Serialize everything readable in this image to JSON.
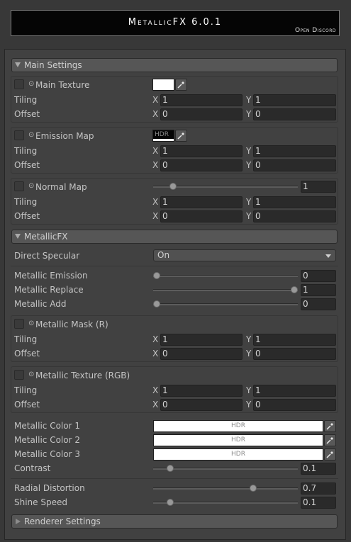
{
  "banner": {
    "title": "MetallicFX 6.0.1",
    "discord_link": "Open Discord"
  },
  "sections": {
    "main_settings": "Main Settings",
    "metallicfx": "MetallicFX",
    "renderer_settings": "Renderer Settings"
  },
  "main_texture": {
    "label": "Main Texture",
    "tiling_label": "Tiling",
    "offset_label": "Offset",
    "tiling_x": "1",
    "tiling_y": "1",
    "offset_x": "0",
    "offset_y": "0"
  },
  "emission_map": {
    "label": "Emission Map",
    "swatch_text": "HDR",
    "tiling_label": "Tiling",
    "offset_label": "Offset",
    "tiling_x": "1",
    "tiling_y": "1",
    "offset_x": "0",
    "offset_y": "0"
  },
  "normal_map": {
    "label": "Normal Map",
    "strength_value": "1",
    "strength_level": 0.12,
    "tiling_label": "Tiling",
    "offset_label": "Offset",
    "tiling_x": "1",
    "tiling_y": "1",
    "offset_x": "0",
    "offset_y": "0"
  },
  "axis": {
    "x": "X",
    "y": "Y"
  },
  "direct_specular": {
    "label": "Direct Specular",
    "value": "On"
  },
  "metallic_emission": {
    "label": "Metallic Emission",
    "value": "0",
    "level": 0.0
  },
  "metallic_replace": {
    "label": "Metallic Replace",
    "value": "1",
    "level": 1.0
  },
  "metallic_add": {
    "label": "Metallic Add",
    "value": "0",
    "level": 0.0
  },
  "metallic_mask": {
    "label": "Metallic Mask (R)",
    "tiling_label": "Tiling",
    "offset_label": "Offset",
    "tiling_x": "1",
    "tiling_y": "1",
    "offset_x": "0",
    "offset_y": "0"
  },
  "metallic_texture": {
    "label": "Metallic Texture (RGB)",
    "tiling_label": "Tiling",
    "offset_label": "Offset",
    "tiling_x": "1",
    "tiling_y": "1",
    "offset_x": "0",
    "offset_y": "0"
  },
  "metallic_colors": [
    {
      "label": "Metallic Color 1",
      "swatch_text": "HDR",
      "color": "#ffffff"
    },
    {
      "label": "Metallic Color 2",
      "swatch_text": "HDR",
      "color": "#ffffff"
    },
    {
      "label": "Metallic Color 3",
      "swatch_text": "HDR",
      "color": "#ffffff"
    }
  ],
  "contrast": {
    "label": "Contrast",
    "value": "0.1",
    "level": 0.1
  },
  "radial_distortion": {
    "label": "Radial Distortion",
    "value": "0.7",
    "level": 0.7
  },
  "shine_speed": {
    "label": "Shine Speed",
    "value": "0.1",
    "level": 0.1
  },
  "colors": {
    "background": "#383838",
    "panel": "#414141",
    "field": "#2a2a2a",
    "header": "#565656"
  },
  "icons": {
    "picker": "eyedropper-icon",
    "tex": "texture-dot-icon"
  }
}
